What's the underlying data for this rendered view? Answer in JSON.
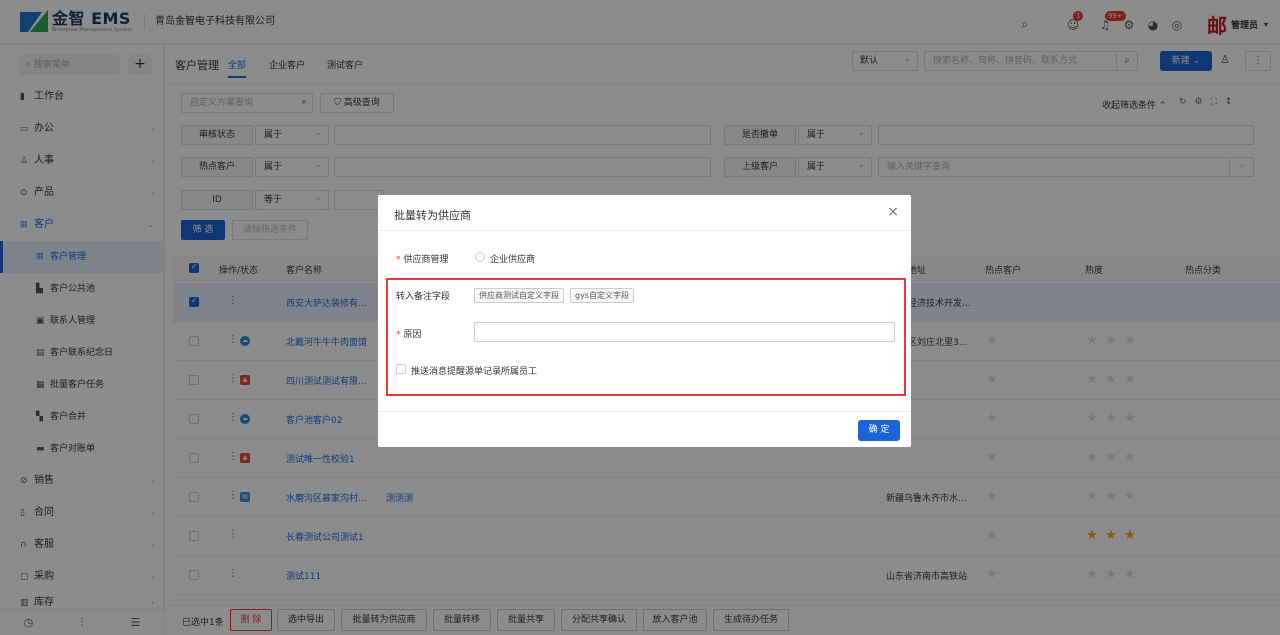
{
  "header": {
    "logo_title": "金智 EMS",
    "logo_sub": "Enterprise Management System",
    "company": "青岛金智电子科技有限公司",
    "badge1": "1",
    "badge2": "99+",
    "brand_mark": "邮",
    "admin": "管理员"
  },
  "sidebar": {
    "search_placeholder": "搜索菜单",
    "plus": "+",
    "items": [
      {
        "label": "工作台"
      },
      {
        "label": "办公"
      },
      {
        "label": "人事"
      },
      {
        "label": "产品"
      },
      {
        "label": "客户"
      },
      {
        "label": "客户管理"
      },
      {
        "label": "客户公共池"
      },
      {
        "label": "联系人管理"
      },
      {
        "label": "客户联系纪念日"
      },
      {
        "label": "批量客户任务"
      },
      {
        "label": "客户合并"
      },
      {
        "label": "客户对账单"
      },
      {
        "label": "销售"
      },
      {
        "label": "合同"
      },
      {
        "label": "客服"
      },
      {
        "label": "采购"
      },
      {
        "label": "库存"
      }
    ]
  },
  "tabs": {
    "title": "客户管理",
    "t1": "全部",
    "t2": "企业客户",
    "t3": "测试客户"
  },
  "toolbar": {
    "sort_default": "默认",
    "search_placeholder": "搜索名称、简称、拼音码、联系方式",
    "new_label": "新建"
  },
  "filter": {
    "scheme_placeholder": "自定义方案查询",
    "advanced": "高级查询",
    "collapse": "收起筛选条件",
    "f_audit": "审核状态",
    "f_hot": "热点客户",
    "f_id": "ID",
    "f_is_supplier": "是否撤单",
    "f_parent": "上级客户",
    "op_belong": "属于",
    "op_equal": "等于",
    "parent_placeholder": "输入关键字查询",
    "filter_btn": "筛 选",
    "clear_btn": "清除筛选条件"
  },
  "table": {
    "h_op": "操作/状态",
    "h_name": "客户名称",
    "h_addr": "地址",
    "h_hotcust": "热点客户",
    "h_heat": "热度",
    "h_hotcat": "热点分类",
    "rows": [
      {
        "name": "西安大萨达装修有...",
        "name2": "",
        "addr": "经济技术开发...",
        "heat": 0
      },
      {
        "name": "北戴河牛牛牛肉面馆",
        "name2": "",
        "addr": "区刘庄北里3...",
        "heat": 0
      },
      {
        "name": "四川测试测试有限...",
        "name2": "",
        "addr": "",
        "heat": 0
      },
      {
        "name": "客户池客户02",
        "name2": "",
        "addr": "",
        "heat": 0
      },
      {
        "name": "测试唯一性校验1",
        "name2": "",
        "addr": "",
        "heat": 0
      },
      {
        "name": "水磨沟区慕家沟村...",
        "name2": "测测测",
        "addr": "新疆乌鲁木齐市水...",
        "heat": 0
      },
      {
        "name": "长春测试公司测试1",
        "name2": "",
        "addr": "",
        "heat": 3
      },
      {
        "name": "测试111",
        "name2": "",
        "addr": "山东省济南市高铁站",
        "heat": 0
      }
    ]
  },
  "bottom": {
    "selected": "已选中1条",
    "delete": "删 除",
    "export": "选中导出",
    "to_supplier": "批量转为供应商",
    "transfer": "批量转移",
    "share": "批量共享",
    "assign_share": "分配共享确认",
    "to_pool": "放入客户池",
    "todo": "生成待办任务"
  },
  "modal": {
    "title": "批量转为供应商",
    "supplier_mgmt": "供应商管理",
    "radio_label": "企业供应商",
    "remark_fields": "转入备注字段",
    "tag1": "供应商测试自定义字段",
    "tag2": "gys自定义字段",
    "reason": "原因",
    "push_label": "推送消息提醒源单记录所属员工",
    "ok": "确 定"
  }
}
